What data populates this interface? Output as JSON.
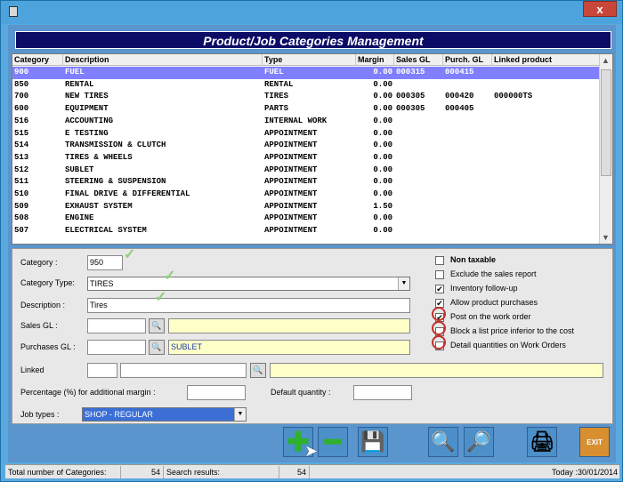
{
  "window": {
    "title": "",
    "close_label": "x"
  },
  "banner": {
    "title": "Product/Job Categories Management"
  },
  "grid": {
    "headers": [
      "Category",
      "Description",
      "Type",
      "Margin",
      "Sales GL",
      "Purch. GL",
      "Linked product"
    ],
    "rows": [
      {
        "category": "900",
        "description": "FUEL",
        "type": "FUEL",
        "margin": "0.00",
        "sales_gl": "000315",
        "purch_gl": "000415",
        "linked": ""
      },
      {
        "category": "850",
        "description": "RENTAL",
        "type": "RENTAL",
        "margin": "0.00",
        "sales_gl": "",
        "purch_gl": "",
        "linked": ""
      },
      {
        "category": "700",
        "description": "NEW TIRES",
        "type": "TIRES",
        "margin": "0.00",
        "sales_gl": "000305",
        "purch_gl": "000420",
        "linked": "000000TS"
      },
      {
        "category": "600",
        "description": "EQUIPMENT",
        "type": "PARTS",
        "margin": "0.00",
        "sales_gl": "000305",
        "purch_gl": "000405",
        "linked": ""
      },
      {
        "category": "516",
        "description": "ACCOUNTING",
        "type": "INTERNAL WORK",
        "margin": "0.00",
        "sales_gl": "",
        "purch_gl": "",
        "linked": ""
      },
      {
        "category": "515",
        "description": "E TESTING",
        "type": "APPOINTMENT",
        "margin": "0.00",
        "sales_gl": "",
        "purch_gl": "",
        "linked": ""
      },
      {
        "category": "514",
        "description": "TRANSMISSION & CLUTCH",
        "type": "APPOINTMENT",
        "margin": "0.00",
        "sales_gl": "",
        "purch_gl": "",
        "linked": ""
      },
      {
        "category": "513",
        "description": "TIRES & WHEELS",
        "type": "APPOINTMENT",
        "margin": "0.00",
        "sales_gl": "",
        "purch_gl": "",
        "linked": ""
      },
      {
        "category": "512",
        "description": "SUBLET",
        "type": "APPOINTMENT",
        "margin": "0.00",
        "sales_gl": "",
        "purch_gl": "",
        "linked": ""
      },
      {
        "category": "511",
        "description": "STEERING & SUSPENSION",
        "type": "APPOINTMENT",
        "margin": "0.00",
        "sales_gl": "",
        "purch_gl": "",
        "linked": ""
      },
      {
        "category": "510",
        "description": "FINAL DRIVE & DIFFERENTIAL",
        "type": "APPOINTMENT",
        "margin": "0.00",
        "sales_gl": "",
        "purch_gl": "",
        "linked": ""
      },
      {
        "category": "509",
        "description": "EXHAUST SYSTEM",
        "type": "APPOINTMENT",
        "margin": "1.50",
        "sales_gl": "",
        "purch_gl": "",
        "linked": ""
      },
      {
        "category": "508",
        "description": "ENGINE",
        "type": "APPOINTMENT",
        "margin": "0.00",
        "sales_gl": "",
        "purch_gl": "",
        "linked": ""
      },
      {
        "category": "507",
        "description": "ELECTRICAL SYSTEM",
        "type": "APPOINTMENT",
        "margin": "0.00",
        "sales_gl": "",
        "purch_gl": "",
        "linked": ""
      }
    ]
  },
  "form": {
    "category_label": "Category :",
    "category_value": "950",
    "category_type_label": "Category Type:",
    "category_type_value": "TIRES",
    "description_label": "Description :",
    "description_value": "Tires",
    "sales_gl_label": "Sales GL :",
    "sales_gl_value": "",
    "sales_gl_desc": "",
    "purchases_gl_label": "Purchases GL :",
    "purchases_gl_value": "",
    "purchases_gl_desc": "SUBLET",
    "linked_label": "Linked",
    "percentage_label": "Percentage (%) for additional margin :",
    "default_qty_label": "Default quantity :",
    "job_types_label": "Job types :",
    "job_types_value": "SHOP - REGULAR",
    "lookup_icon": "magnifier-icon"
  },
  "options": [
    {
      "label": "Non taxable",
      "checked": false,
      "bold": true
    },
    {
      "label": "Exclude the sales report",
      "checked": false
    },
    {
      "label": "Inventory follow-up",
      "checked": true
    },
    {
      "label": "Allow product purchases",
      "checked": true
    },
    {
      "label": "Post on the work order",
      "checked": true
    },
    {
      "label": "Block a list price inferior to the cost",
      "checked": false
    },
    {
      "label": "Detail quantities on Work Orders",
      "checked": false
    }
  ],
  "toolbar": {
    "add_icon": "plus-icon",
    "remove_icon": "minus-icon",
    "save_icon": "floppy-icon",
    "search_icon": "search-icon",
    "view_icon": "eye-icon",
    "print_icon": "printer-icon",
    "exit_label": "EXIT"
  },
  "status": {
    "total_label": "Total number of Categories:",
    "total_value": "54",
    "search_label": "Search results:",
    "search_value": "54",
    "today": "Today :30/01/2014"
  },
  "colors": {
    "selected_row": "#7f7fff",
    "banner": "#0c0c66",
    "highlight_field": "#ffffc8"
  }
}
